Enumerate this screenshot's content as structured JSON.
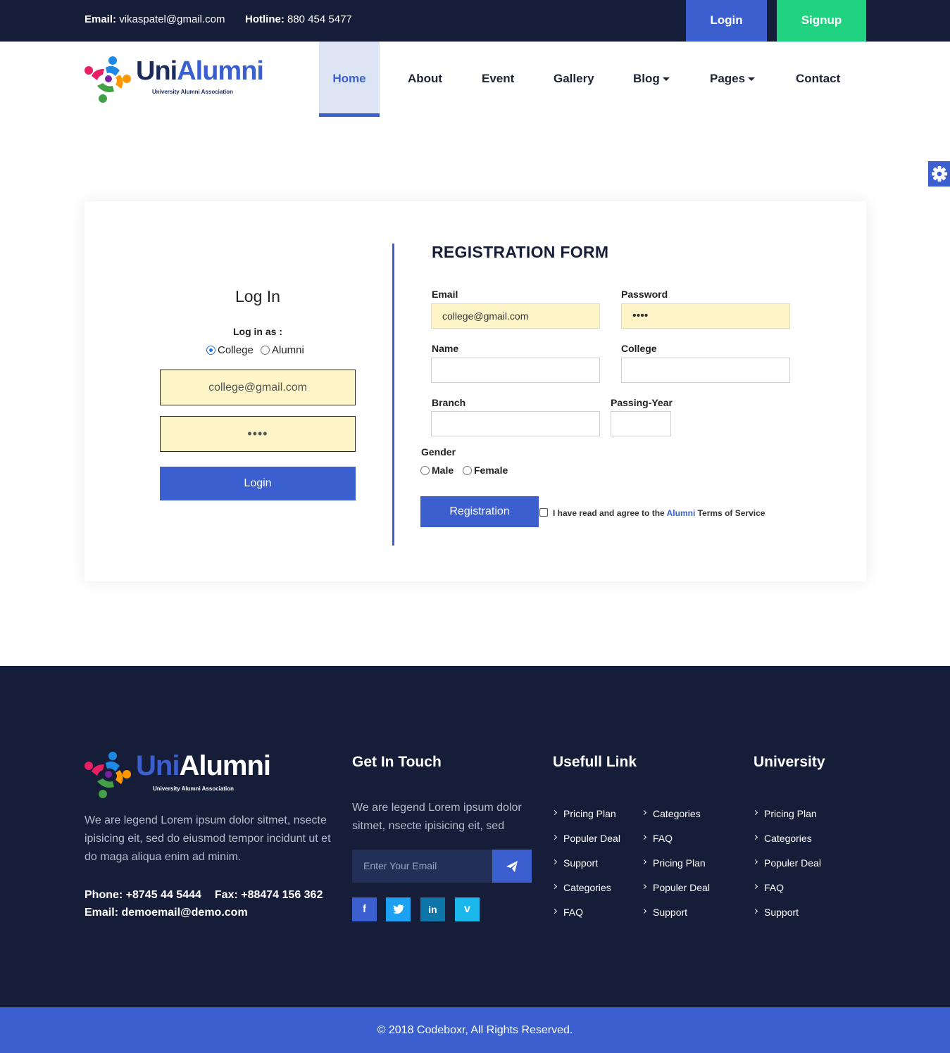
{
  "topbar": {
    "email_label": "Email:",
    "email_value": "vikaspatel@gmail.com",
    "hotline_label": "Hotline:",
    "hotline_value": "880 454 5477",
    "login": "Login",
    "signup": "Signup"
  },
  "brand": {
    "name_part1": "Uni",
    "name_part2": "Alumni",
    "tagline": "University Alumni Association"
  },
  "nav": {
    "items": [
      {
        "label": "Home",
        "active": true
      },
      {
        "label": "About"
      },
      {
        "label": "Event"
      },
      {
        "label": "Gallery"
      },
      {
        "label": "Blog",
        "dropdown": true
      },
      {
        "label": "Pages",
        "dropdown": true
      },
      {
        "label": "Contact"
      }
    ]
  },
  "login_panel": {
    "title": "Log In",
    "login_as": "Log in as :",
    "options": [
      "College",
      "Alumni"
    ],
    "selected": "College",
    "email_value": "college@gmail.com",
    "password_value": "••••",
    "button": "Login"
  },
  "registration": {
    "title": "REGISTRATION FORM",
    "email_label": "Email",
    "email_value": "college@gmail.com",
    "password_label": "Password",
    "password_value": "••••",
    "name_label": "Name",
    "college_label": "College",
    "branch_label": "Branch",
    "passing_year_label": "Passing-Year",
    "gender_label": "Gender",
    "gender_options": [
      "Male",
      "Female"
    ],
    "button": "Registration",
    "terms_prefix": "I have read and agree to the",
    "terms_link": "Alumni",
    "terms_suffix": "Terms of Service"
  },
  "footer": {
    "about": "We are legend Lorem ipsum dolor sitmet, nsecte ipisicing eit, sed do eiusmod tempor incidunt ut et do maga aliqua enim ad minim.",
    "phone": "Phone: +8745 44 5444",
    "fax": "Fax: +88474 156 362",
    "email": "Email: demoemail@demo.com",
    "get_in_touch": {
      "heading": "Get In Touch",
      "text": "We are legend Lorem ipsum dolor sitmet, nsecte ipisicing eit, sed",
      "email_placeholder": "Enter Your Email"
    },
    "social": [
      "facebook-icon",
      "twitter-icon",
      "linkedin-icon",
      "vimeo-icon"
    ],
    "useful_links": {
      "heading": "Usefull Link",
      "col1": [
        "Pricing Plan",
        "Populer Deal",
        "Support",
        "Categories",
        "FAQ"
      ],
      "col2": [
        "Categories",
        "FAQ",
        "Pricing Plan",
        "Populer Deal",
        "Support"
      ]
    },
    "university": {
      "heading": "University",
      "links": [
        "Pricing Plan",
        "Categories",
        "Populer Deal",
        "FAQ",
        "Support"
      ]
    }
  },
  "copyright": "© 2018 Codeboxr, All Rights Reserved.",
  "colors": {
    "dark_navy": "#161d39",
    "primary_blue": "#3b5fcf",
    "signup_green": "#20d27f",
    "autofill_yellow": "#fdf5c7"
  }
}
